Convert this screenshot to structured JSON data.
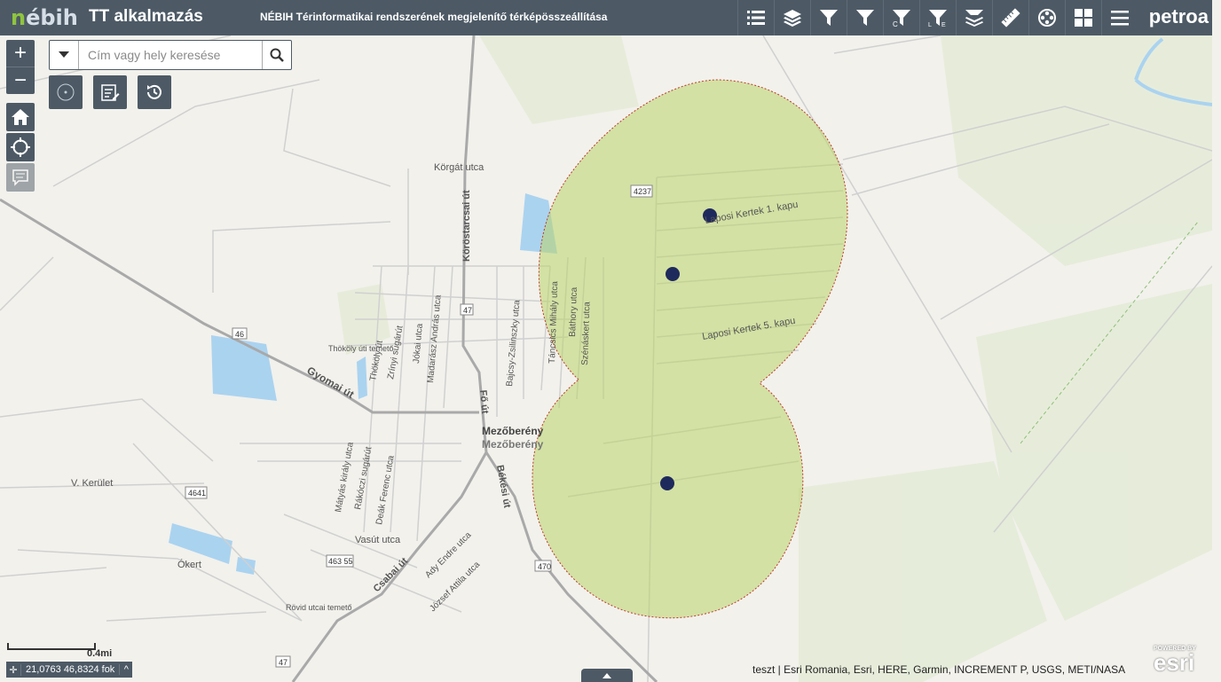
{
  "header": {
    "logo_text": "nébih",
    "app_title": "TT alkalmazás",
    "subtitle": "NÉBIH Térinformatikai rendszerének megjelenítő térképösszeállítása",
    "brand": "petroa",
    "tools": [
      {
        "icon": "legend-list-icon"
      },
      {
        "icon": "layers-icon"
      },
      {
        "icon": "filter-icon"
      },
      {
        "icon": "filter-icon"
      },
      {
        "icon": "filter-c-icon"
      },
      {
        "icon": "filter-le-icon"
      },
      {
        "icon": "layer-filter-icon"
      },
      {
        "icon": "measure-icon"
      },
      {
        "icon": "film-reel-icon"
      },
      {
        "icon": "grid-icon"
      },
      {
        "icon": "menu-icon"
      }
    ]
  },
  "search": {
    "placeholder": "Cím vagy hely keresése"
  },
  "map": {
    "labels": {
      "korgat": "Körgát utca",
      "korostarcsai": "Köröstarcsai út",
      "road4237": "4237",
      "road47a": "47",
      "road46": "46",
      "thokoly_cem": "Thököly úti temető",
      "thokoly_ut": "Thököly út",
      "zrinyi": "Zrínyi sugárút",
      "jokai": "Jókai utca",
      "madarasz": "Madarász András utca",
      "bajcsy": "Bajcsy-Zsilinszky utca",
      "tancsics": "Táncsics Mihály utca",
      "bathory": "Báthory utca",
      "szenaskert": "Szénáskert utca",
      "laposi1": "Laposi Kertek 1. kapu",
      "laposi5": "Laposi Kertek 5. kapu",
      "gyomai": "Gyomai út",
      "fout": "Fő út",
      "city1": "Mezőberény",
      "city2": "Mezőberény",
      "v_kerulet": "V. Kerület",
      "road4641": "4641",
      "matyas": "Mátyás király utca",
      "rakoczi": "Rákóczi sugárút",
      "deak": "Deák Ferenc utca",
      "bekesi": "Békési út",
      "vasut": "Vasút utca",
      "ady": "Ady Endre utca",
      "jozsef": "József Attila utca",
      "road46355": "463 55",
      "road470": "470",
      "csabai": "Csabai út",
      "okert": "Ókert",
      "rovid_cem": "Rövid utcai temető",
      "road47b": "47"
    },
    "colors": {
      "buffer_fill": "#b9d36a",
      "buffer_stroke": "#c0392b",
      "point": "#1f2a5c",
      "water": "#aad3f0"
    }
  },
  "scale": {
    "label": "0.4mi"
  },
  "coordinates": {
    "text": "21,0763 46,8324 fok"
  },
  "attribution": "teszt | Esri Romania, Esri, HERE, Garmin, INCREMENT P, USGS, METI/NASA",
  "esri": {
    "powered": "POWERED BY",
    "name": "esri"
  }
}
